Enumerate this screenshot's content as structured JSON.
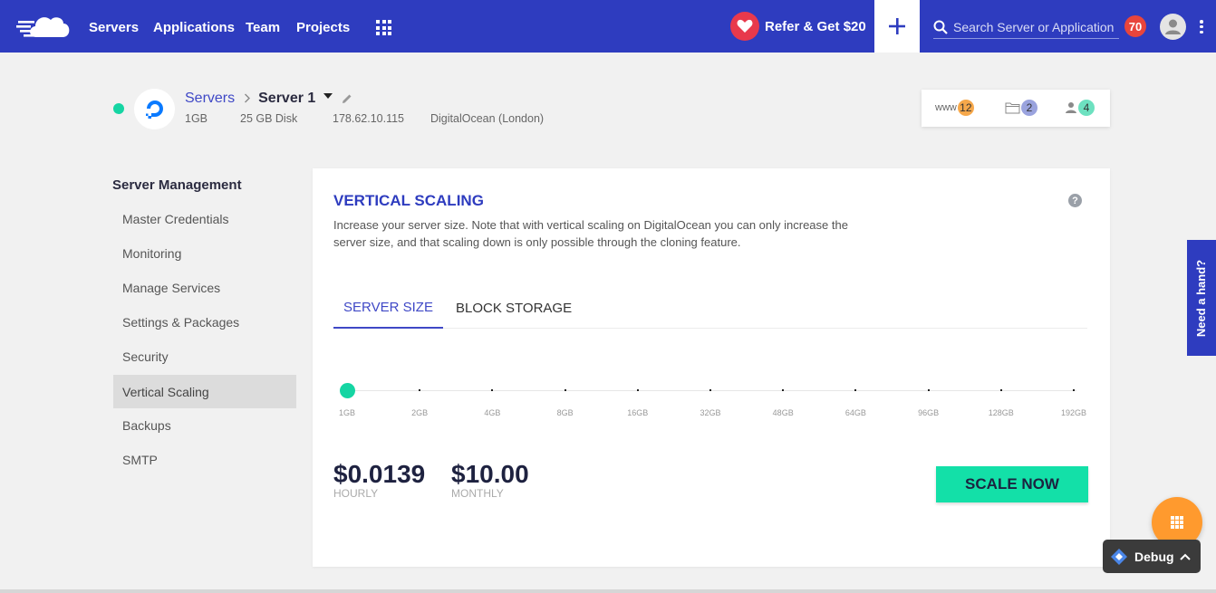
{
  "topbar": {
    "nav": [
      "Servers",
      "Applications",
      "Team",
      "Projects"
    ],
    "refer_label": "Refer & Get $20",
    "search_placeholder": "Search Server or Application",
    "notification_count": "70",
    "brand_color": "#2e3cbf"
  },
  "server": {
    "breadcrumb_root": "Servers",
    "breadcrumb_current": "Server 1",
    "ram": "1GB",
    "disk": "25 GB Disk",
    "ip": "178.62.10.115",
    "provider": "DigitalOcean (London)",
    "status_color": "#15d5a3"
  },
  "counters": {
    "www_label": "www",
    "www_count": "12",
    "folders_count": "2",
    "users_count": "4"
  },
  "sidebar": {
    "title": "Server Management",
    "items": [
      {
        "label": "Master Credentials"
      },
      {
        "label": "Monitoring"
      },
      {
        "label": "Manage Services"
      },
      {
        "label": "Settings & Packages"
      },
      {
        "label": "Security"
      },
      {
        "label": "Vertical Scaling"
      },
      {
        "label": "Backups"
      },
      {
        "label": "SMTP"
      }
    ],
    "active": "Vertical Scaling"
  },
  "main": {
    "title": "VERTICAL SCALING",
    "description": "Increase your server size. Note that with vertical scaling on DigitalOcean you can only increase the server size, and that scaling down is only possible through the cloning feature.",
    "tabs": [
      "SERVER SIZE",
      "BLOCK STORAGE"
    ],
    "active_tab": "SERVER SIZE",
    "slider": {
      "options": [
        "1GB",
        "2GB",
        "4GB",
        "8GB",
        "16GB",
        "32GB",
        "48GB",
        "64GB",
        "96GB",
        "128GB",
        "192GB"
      ],
      "selected": "1GB"
    },
    "hourly_price": "$0.0139",
    "hourly_label": "HOURLY",
    "monthly_price": "$10.00",
    "monthly_label": "MONTHLY",
    "scale_button": "SCALE NOW",
    "accent_color": "#13e0a8"
  },
  "floating": {
    "need_hand": "Need a hand?",
    "debug_label": "Debug"
  }
}
